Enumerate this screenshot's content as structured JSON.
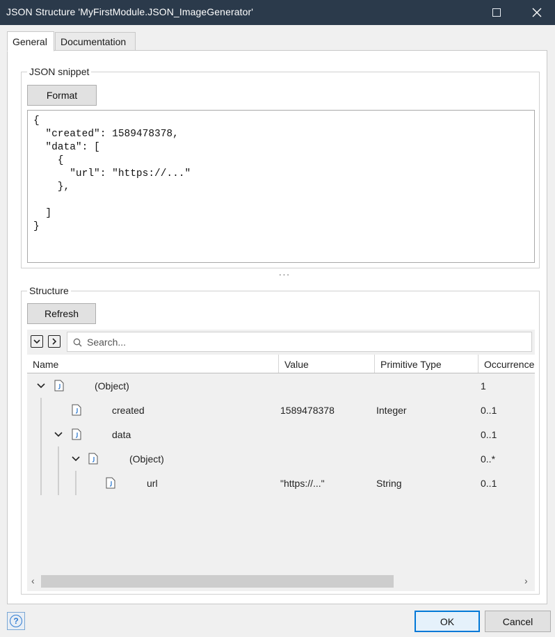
{
  "window": {
    "title": "JSON Structure 'MyFirstModule.JSON_ImageGenerator'"
  },
  "tabs": [
    {
      "label": "General",
      "active": true
    },
    {
      "label": "Documentation",
      "active": false
    }
  ],
  "json_snippet": {
    "group_label": "JSON snippet",
    "format_label": "Format",
    "code": "{\n  \"created\": 1589478378,\n  \"data\": [\n    {\n      \"url\": \"https://...\"\n    },\n\n  ]\n}"
  },
  "splitter": "...",
  "structure": {
    "group_label": "Structure",
    "refresh_label": "Refresh",
    "search_placeholder": "Search...",
    "columns": [
      "Name",
      "Value",
      "Primitive Type",
      "Occurrence"
    ],
    "rows": [
      {
        "name": "(Object)",
        "value": "",
        "type": "",
        "occurrence": "1"
      },
      {
        "name": "created",
        "value": "1589478378",
        "type": "Integer",
        "occurrence": "0..1"
      },
      {
        "name": "data",
        "value": "",
        "type": "",
        "occurrence": "0..1"
      },
      {
        "name": "(Object)",
        "value": "",
        "type": "",
        "occurrence": "0..*"
      },
      {
        "name": "url",
        "value": "\"https://...\"",
        "type": "String",
        "occurrence": "0..1"
      }
    ]
  },
  "footer": {
    "help_label": "?",
    "ok_label": "OK",
    "cancel_label": "Cancel"
  },
  "colors": {
    "titlebar": "#2b3a4b",
    "accent": "#0078d7",
    "icon_blue": "#2f7bd1"
  },
  "icons": {
    "close": "close-icon",
    "maximize": "maximize-icon",
    "collapse_all": "collapse-all-icon",
    "expand_all": "expand-all-icon",
    "search": "search-icon",
    "json_node": "json-node-icon",
    "chevron": "chevron-down-icon",
    "help": "help-icon"
  }
}
